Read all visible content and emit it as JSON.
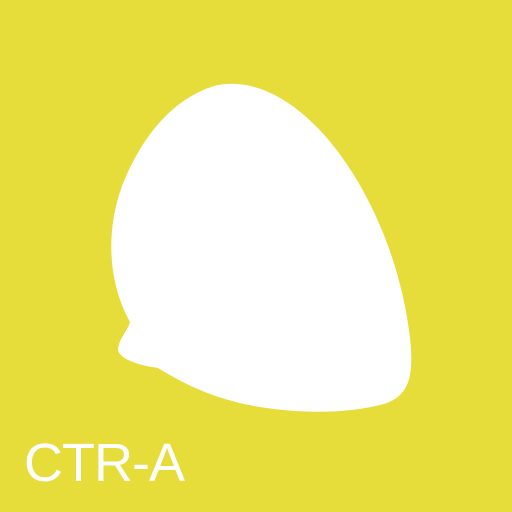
{
  "tile": {
    "background_color": "#E6DC3A",
    "shape_color": "#FFFFFF",
    "shape_icon": "white-blob-shape",
    "label": "CTR-A"
  }
}
